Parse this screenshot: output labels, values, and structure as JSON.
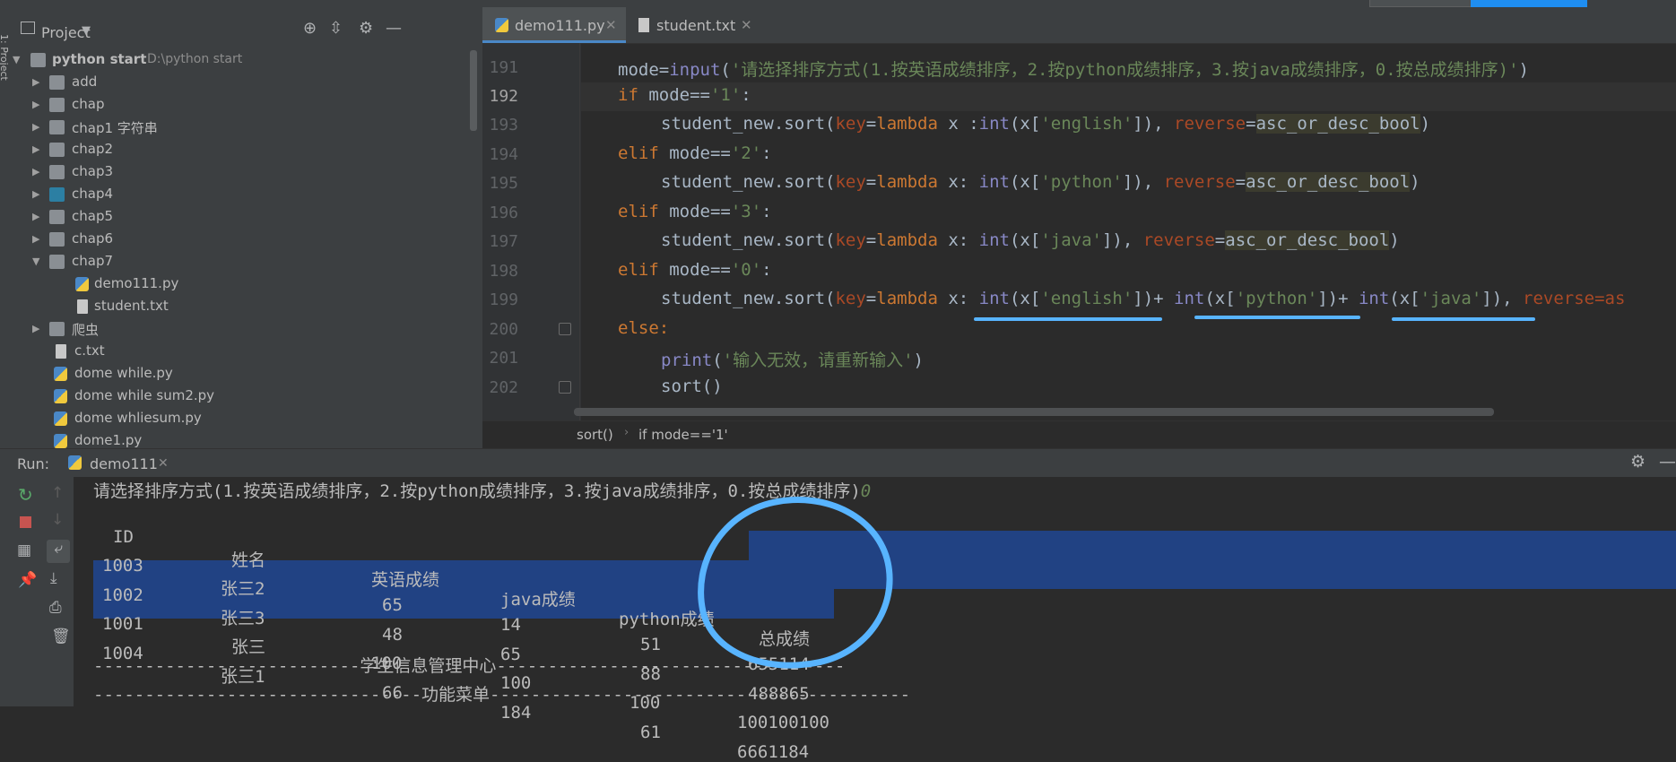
{
  "project_panel": {
    "title": "Project",
    "root": {
      "name": "python start",
      "path": "D:\\python start"
    },
    "items": [
      {
        "label": "add",
        "type": "folder",
        "expanded": false
      },
      {
        "label": "chap",
        "type": "folder",
        "expanded": false
      },
      {
        "label": "chap1 字符串",
        "type": "folder",
        "expanded": false
      },
      {
        "label": "chap2",
        "type": "folder",
        "expanded": false
      },
      {
        "label": "chap3",
        "type": "folder",
        "expanded": false
      },
      {
        "label": "chap4",
        "type": "folder",
        "expanded": false
      },
      {
        "label": "chap5",
        "type": "folder",
        "expanded": false
      },
      {
        "label": "chap6",
        "type": "folder",
        "expanded": false
      },
      {
        "label": "chap7",
        "type": "folder",
        "expanded": true
      },
      {
        "label": "demo111.py",
        "type": "py-file"
      },
      {
        "label": "student.txt",
        "type": "txt-file"
      },
      {
        "label": "爬虫",
        "type": "folder",
        "expanded": false
      },
      {
        "label": "c.txt",
        "type": "txt-file"
      },
      {
        "label": "dome while.py",
        "type": "py-file"
      },
      {
        "label": "dome while sum2.py",
        "type": "py-file"
      },
      {
        "label": "dome whliesum.py",
        "type": "py-file"
      },
      {
        "label": "dome1.py",
        "type": "py-file"
      }
    ]
  },
  "tool_strip": {
    "label": "1: Project"
  },
  "editor": {
    "tabs": [
      {
        "label": "demo111.py",
        "active": true
      },
      {
        "label": "student.txt",
        "active": false
      }
    ],
    "line_numbers": [
      "191",
      "192",
      "193",
      "194",
      "195",
      "196",
      "197",
      "198",
      "199",
      "200",
      "201",
      "202"
    ],
    "current_line": "192",
    "code": {
      "l191_a": "mode=",
      "l191_b": "input",
      "l191_c": "(",
      "l191_d": "'请选择排序方式(1.按英语成绩排序，2.按python成绩排序，3.按java成绩排序，0.按总成绩排序)'",
      "l191_e": ")",
      "if": "if",
      "l192_b": " mode==",
      "l192_c": "'1'",
      "l192_d": ":",
      "student_sort": "student_new.sort(",
      "key": "key",
      "eq_lambda": "=",
      "lambda": "lambda",
      "x_space_colon": " x :",
      "x_colon": " x: ",
      "int": "int",
      "x_open": "(x[",
      "english": "'english'",
      "python": "'python'",
      "java": "'java'",
      "close_comma": "]), ",
      "close_plus": "])+ ",
      "reverse": "reverse",
      "eq": "=",
      "asc": "asc_or_desc_bool",
      "paren_close": ")",
      "elif": "elif",
      "mode_eq": " mode==",
      "v2": "'2'",
      "v3": "'3'",
      "v0": "'0'",
      "colon": ":",
      "reverse_cut": "reverse=as",
      "else": "else:",
      "print": "print",
      "print_arg": "'输入无效，请重新输入'",
      "sort_call": "sort()"
    },
    "breadcrumb": [
      "sort()",
      "if mode=='1'"
    ]
  },
  "run_panel": {
    "label": "Run:",
    "tab": "demo111",
    "prompt": "请选择排序方式(1.按英语成绩排序，2.按python成绩排序，3.按java成绩排序，0.按总成绩排序)",
    "input": "0",
    "headers": [
      "ID",
      "姓名",
      "英语成绩",
      "java成绩",
      "python成绩",
      "总成绩"
    ],
    "rows": [
      [
        "1003",
        "张三2",
        "65",
        "14",
        "51",
        "655114"
      ],
      [
        "1002",
        "张三3",
        "48",
        "65",
        "88",
        "488865"
      ],
      [
        "1001",
        "张三",
        "100",
        "100",
        "100",
        "100100100"
      ],
      [
        "1004",
        "张三1",
        "66",
        "184",
        "61",
        "6661184"
      ]
    ],
    "footer1": "--------------------------学生信息管理中心----------------------------------",
    "footer2": "--------------------------------功能菜单-----------------------------------------"
  },
  "colors": {
    "accent": "#4a88c7",
    "selection": "#214283",
    "annotation": "#58b4ff"
  }
}
